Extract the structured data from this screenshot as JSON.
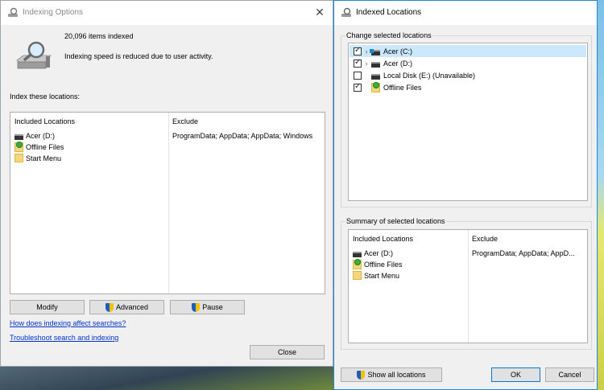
{
  "indexing_options": {
    "title": "Indexing Options",
    "items_indexed": "20,096 items indexed",
    "status_message": "Indexing speed is reduced due to user activity.",
    "index_locations_label": "Index these locations:",
    "table": {
      "col_included": "Included Locations",
      "col_exclude": "Exclude",
      "rows": [
        {
          "name": "Acer (D:)",
          "icon": "drive-icon",
          "exclude": "ProgramData; AppData; AppData; Windows"
        },
        {
          "name": "Offline Files",
          "icon": "offline-files-icon",
          "exclude": ""
        },
        {
          "name": "Start Menu",
          "icon": "folder-icon",
          "exclude": ""
        }
      ]
    },
    "buttons": {
      "modify": "Modify",
      "advanced": "Advanced",
      "pause": "Pause",
      "close": "Close"
    },
    "links": {
      "how_indexing": "How does indexing affect searches?",
      "troubleshoot": "Troubleshoot search and indexing"
    }
  },
  "indexed_locations": {
    "title": "Indexed Locations",
    "change_label": "Change selected locations",
    "tree": [
      {
        "name": "Acer (C:)",
        "checked": true,
        "expandable": true,
        "selected": true
      },
      {
        "name": "Acer (D:)",
        "checked": true,
        "expandable": true,
        "selected": false
      },
      {
        "name": "Local Disk (E:) (Unavailable)",
        "checked": false,
        "expandable": false,
        "selected": false
      },
      {
        "name": "Offline Files",
        "checked": true,
        "expandable": false,
        "selected": false
      }
    ],
    "summary_label": "Summary of selected locations",
    "summary": {
      "col_included": "Included Locations",
      "col_exclude": "Exclude",
      "rows": [
        {
          "name": "Acer (D:)",
          "exclude": "ProgramData; AppData; AppD..."
        },
        {
          "name": "Offline Files",
          "exclude": ""
        },
        {
          "name": "Start Menu",
          "exclude": ""
        }
      ]
    },
    "buttons": {
      "show_all": "Show all locations",
      "ok": "OK",
      "cancel": "Cancel"
    }
  },
  "colors": {
    "accent": "#0078d7",
    "link": "#0033cc",
    "selection": "#cce8ff"
  }
}
